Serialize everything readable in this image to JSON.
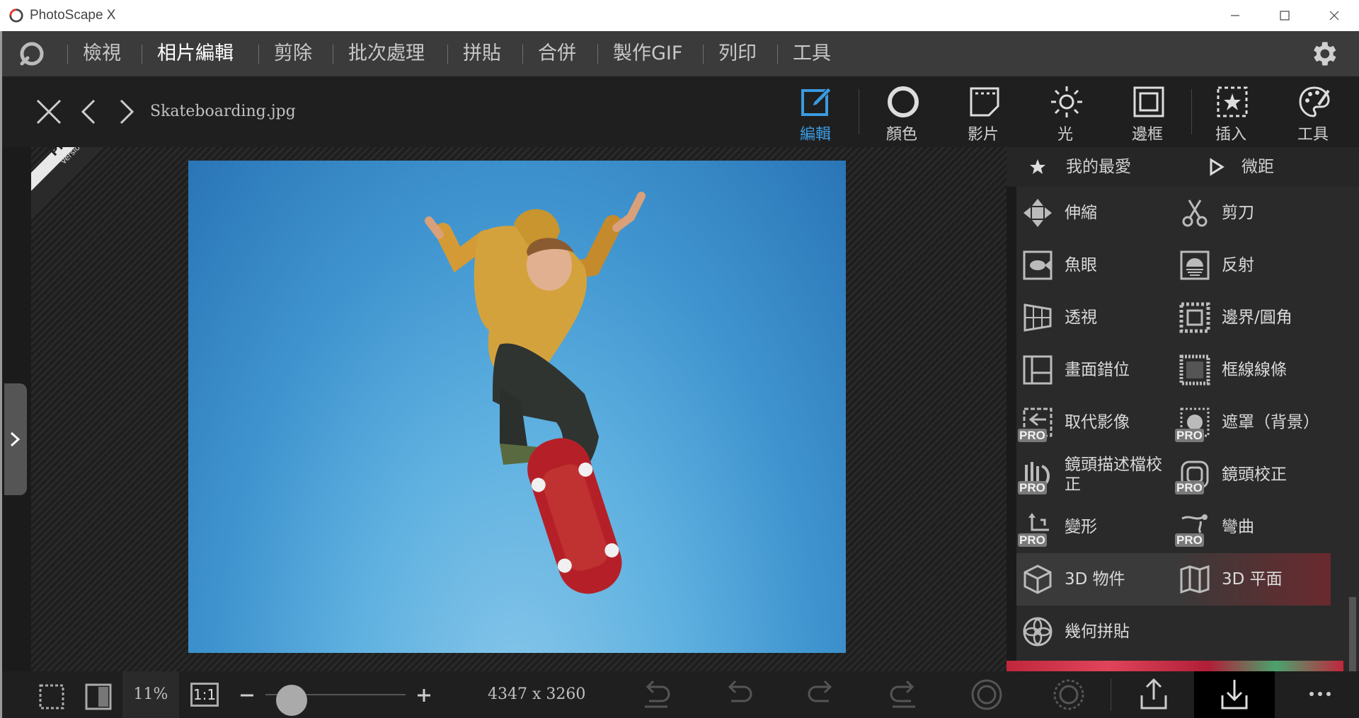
{
  "window": {
    "title": "PhotoScape X"
  },
  "menu": {
    "items": [
      "檢視",
      "相片編輯",
      "剪除",
      "批次處理",
      "拼貼",
      "合併",
      "製作GIF",
      "列印",
      "工具"
    ],
    "active_index": 1
  },
  "toolbar": {
    "filename": "Skateboarding.jpg",
    "tools": [
      {
        "label": "編輯",
        "icon": "edit-icon",
        "active": true
      },
      {
        "label": "顏色",
        "icon": "color-circle-icon"
      },
      {
        "label": "影片",
        "icon": "film-icon"
      },
      {
        "label": "光",
        "icon": "sun-icon"
      },
      {
        "label": "邊框",
        "icon": "frame-icon"
      },
      {
        "label": "插入",
        "icon": "insert-star-icon"
      },
      {
        "label": "工具",
        "icon": "palette-icon"
      }
    ]
  },
  "canvas": {
    "pro_ribbon": {
      "line1": "PRO",
      "line2": "Version"
    }
  },
  "panel": {
    "favorites_label": "我的最愛",
    "tiny_label": "微距",
    "items": [
      {
        "label": "伸縮",
        "icon": "move-arrows-icon",
        "pro": false
      },
      {
        "label": "剪刀",
        "icon": "scissors-icon",
        "pro": false
      },
      {
        "label": "魚眼",
        "icon": "fisheye-icon",
        "pro": false
      },
      {
        "label": "反射",
        "icon": "reflection-icon",
        "pro": false
      },
      {
        "label": "透視",
        "icon": "perspective-grid-icon",
        "pro": false
      },
      {
        "label": "邊界/圓角",
        "icon": "border-corner-icon",
        "pro": false
      },
      {
        "label": "畫面錯位",
        "icon": "split-frame-icon",
        "pro": false
      },
      {
        "label": "框線線條",
        "icon": "frame-lines-icon",
        "pro": false
      },
      {
        "label": "取代影像",
        "icon": "replace-image-icon",
        "pro": true
      },
      {
        "label": "遮罩（背景）",
        "icon": "mask-background-icon",
        "pro": true
      },
      {
        "label": "鏡頭描述檔校正",
        "icon": "lens-profile-icon",
        "pro": true
      },
      {
        "label": "鏡頭校正",
        "icon": "lens-correction-icon",
        "pro": true
      },
      {
        "label": "變形",
        "icon": "transform-icon",
        "pro": true
      },
      {
        "label": "彎曲",
        "icon": "warp-icon",
        "pro": true
      },
      {
        "label": "3D 物件",
        "icon": "cube-icon",
        "pro": false
      },
      {
        "label": "3D 平面",
        "icon": "map-plane-icon",
        "pro": false
      },
      {
        "label": "幾何拼貼",
        "icon": "geometric-collage-icon",
        "pro": false
      }
    ],
    "pro_badge": "PRO"
  },
  "bottombar": {
    "zoom": "11%",
    "actual_size_label": "1:1",
    "dimensions": "4347 x 3260",
    "zoom_slider_value": 0.1
  }
}
